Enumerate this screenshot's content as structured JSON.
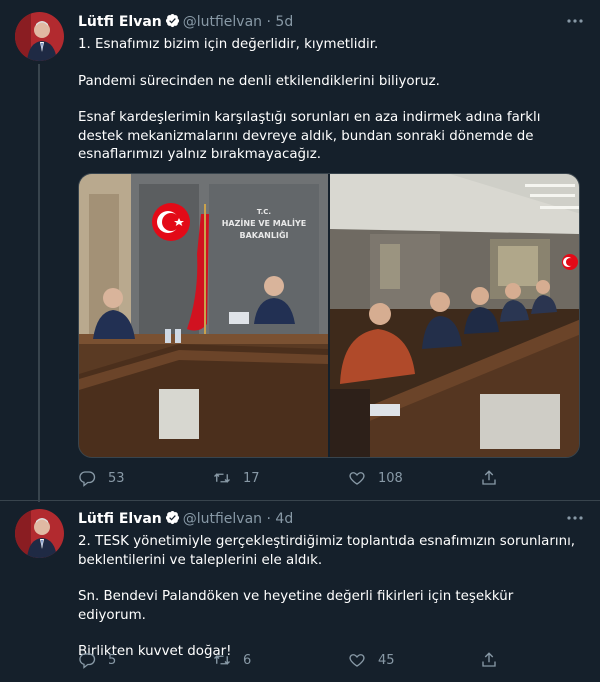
{
  "tweets": [
    {
      "name": "Lütfi Elvan",
      "handle": "@lutfielvan",
      "dot": " · ",
      "time": "5d",
      "paragraphs": [
        "1. Esnafımız bizim için değerlidir, kıymetlidir.",
        "Pandemi sürecinden ne denli etkilendiklerini biliyoruz.",
        "Esnaf kardeşlerimin karşılaştığı sorunları en aza indirmek adına farklı destek mekanizmalarını devreye aldık, bundan sonraki dönemde de esnaflarımızı yalnız bırakmayacağız."
      ],
      "photo_sign": "T.C.\nHAZİNE VE MALİYE\nBAKANLIĞI",
      "stats": {
        "replies": "53",
        "retweets": "17",
        "likes": "108"
      }
    },
    {
      "name": "Lütfi Elvan",
      "handle": "@lutfielvan",
      "dot": " · ",
      "time": "4d",
      "paragraphs": [
        "2. TESK yönetimiyle gerçekleştirdiğimiz toplantıda esnafımızın sorunlarını, beklentilerini ve taleplerini ele aldık.",
        "Sn. Bendevi Palandöken ve heyetine değerli fikirleri için teşekkür ediyorum.",
        "Birlikten kuvvet doğar!"
      ],
      "stats": {
        "replies": "5",
        "retweets": "6",
        "likes": "45"
      }
    }
  ],
  "colors": {
    "background": "#15202b",
    "muted": "#8899a6",
    "verified": "#ffffff",
    "divider": "#38444d"
  },
  "icons": [
    "reply-icon",
    "retweet-icon",
    "like-icon",
    "share-icon",
    "more-icon",
    "verified-icon"
  ]
}
